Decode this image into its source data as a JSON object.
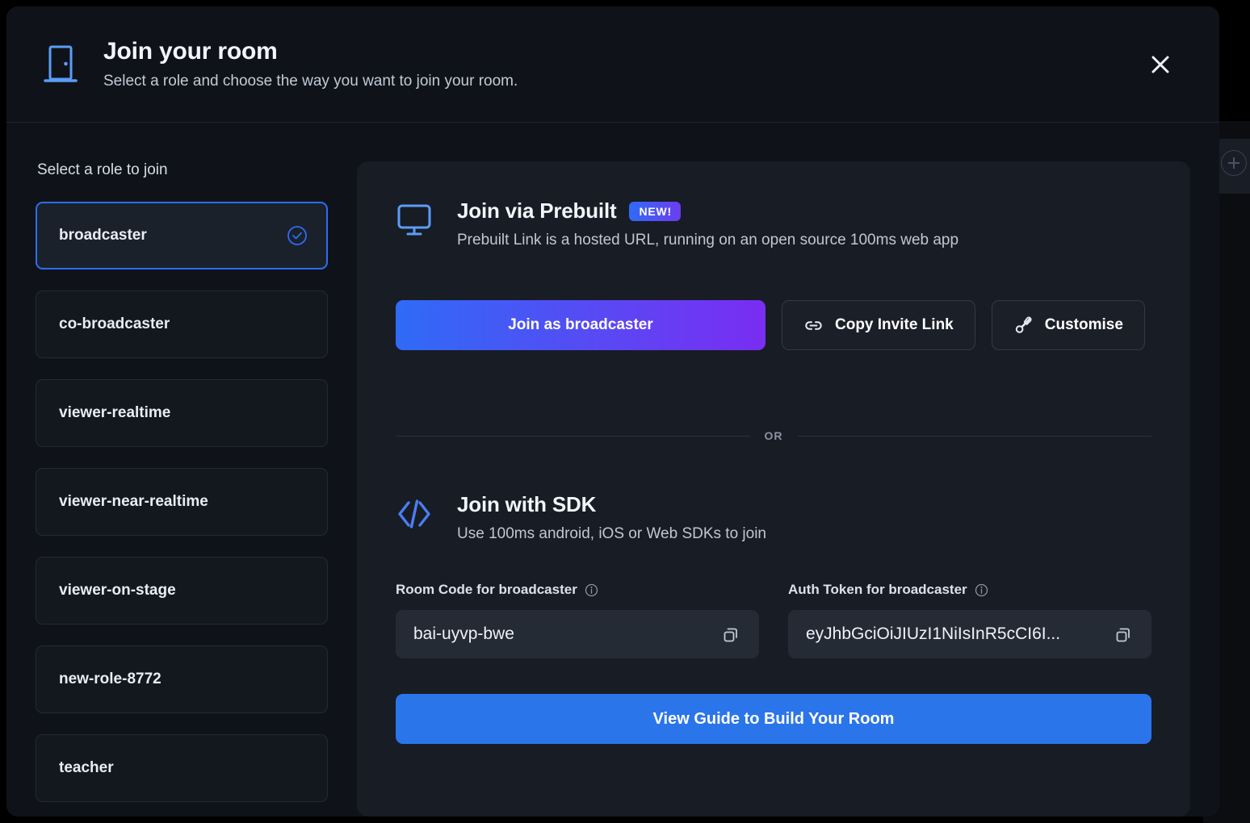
{
  "header": {
    "icon": "door-icon",
    "title": "Join your room",
    "subtitle": "Select a role and choose the way you want to join your room.",
    "close_icon": "close-icon"
  },
  "roles_panel": {
    "title": "Select a role to join",
    "selected": "broadcaster",
    "items": [
      {
        "label": "broadcaster",
        "selected": true
      },
      {
        "label": "co-broadcaster",
        "selected": false
      },
      {
        "label": "viewer-realtime",
        "selected": false
      },
      {
        "label": "viewer-near-realtime",
        "selected": false
      },
      {
        "label": "viewer-on-stage",
        "selected": false
      },
      {
        "label": "new-role-8772",
        "selected": false
      },
      {
        "label": "teacher",
        "selected": false
      }
    ]
  },
  "prebuilt": {
    "icon": "monitor-icon",
    "title": "Join via Prebuilt",
    "badge": "NEW!",
    "subtitle": "Prebuilt Link is a hosted URL, running on an open source 100ms web app",
    "join_button": "Join as broadcaster",
    "copy_invite_button": "Copy Invite Link",
    "copy_invite_icon": "link-icon",
    "customise_button": "Customise",
    "customise_icon": "brush-icon"
  },
  "divider": {
    "text": "OR"
  },
  "sdk": {
    "icon": "code-icon",
    "title": "Join with SDK",
    "subtitle": "Use 100ms android, iOS or Web SDKs to join",
    "room_code": {
      "label": "Room Code for broadcaster",
      "info_icon": "info-icon",
      "value": "bai-uyvp-bwe",
      "copy_icon": "copy-icon"
    },
    "auth_token": {
      "label": "Auth Token for broadcaster",
      "info_icon": "info-icon",
      "value": "eyJhbGciOiJIUzI1NiIsInR5cCI6I...",
      "copy_icon": "copy-icon"
    },
    "guide_button": "View Guide to Build Your Room"
  },
  "background": {
    "add_icon": "plus-circle-icon"
  },
  "colors": {
    "accent_blue": "#2b6ef5",
    "gradient_start": "#2f6bf6",
    "gradient_end": "#7a2df2",
    "guide_blue": "#2b75eb",
    "modal_bg": "#0f1319",
    "panel_bg": "#181c24",
    "field_bg": "#252b35"
  }
}
